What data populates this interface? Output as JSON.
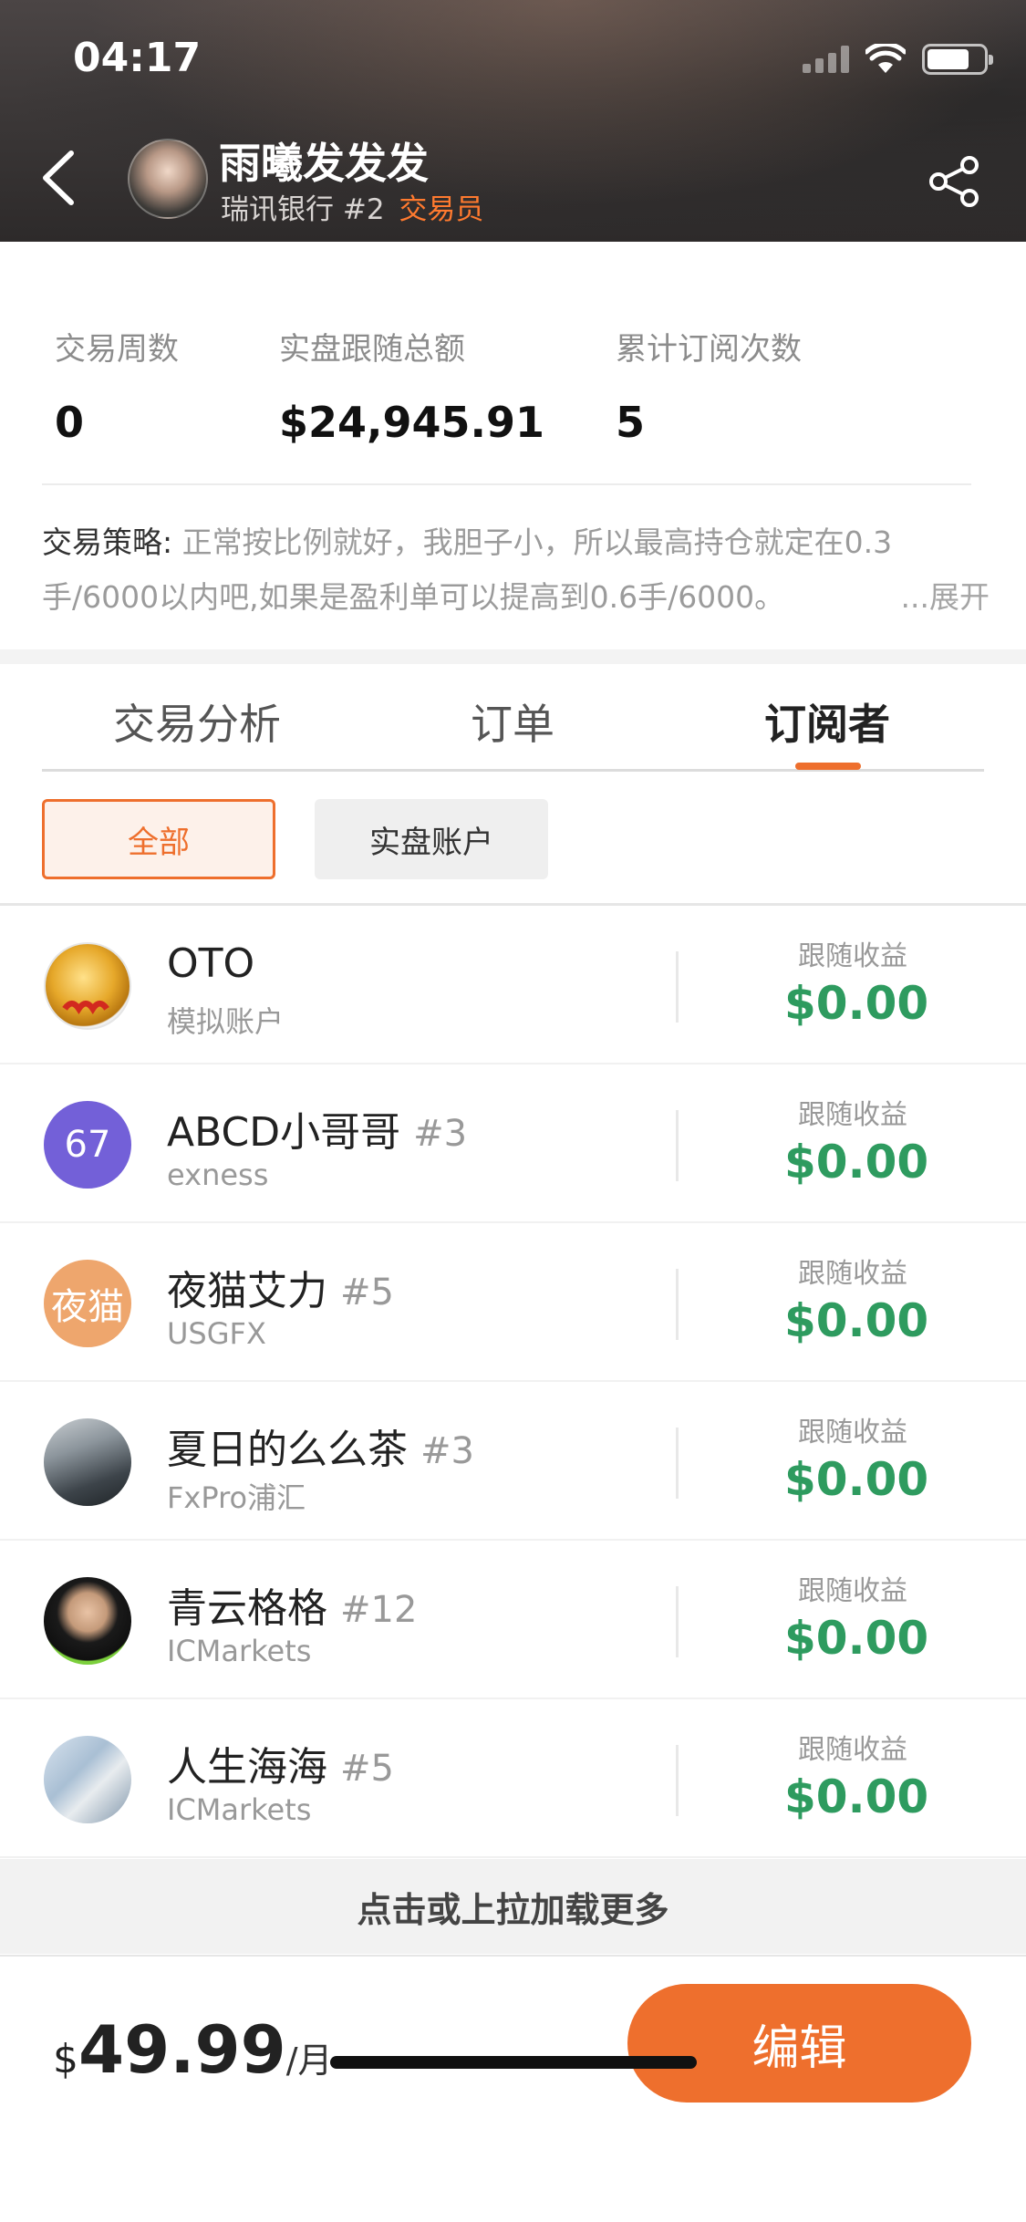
{
  "status_bar": {
    "time": "04:17"
  },
  "header": {
    "trader_name": "雨曦发发发",
    "bank": "瑞讯银行",
    "rank": "#2",
    "role": "交易员",
    "icons": {
      "back": "chevron-left-icon",
      "share": "share-icon"
    }
  },
  "stats": [
    {
      "label": "交易周数",
      "value": "0"
    },
    {
      "label": "实盘跟随总额",
      "value": "$24,945.91"
    },
    {
      "label": "累计订阅次数",
      "value": "5"
    }
  ],
  "strategy": {
    "label": "交易策略:",
    "text": " 正常按比例就好，我胆子小，所以最高持仓就定在0.3手/6000以内吧,如果是盈利单可以提高到0.6手/6000。",
    "expand": "...展开"
  },
  "tabs": [
    {
      "label": "交易分析",
      "active": false
    },
    {
      "label": "订单",
      "active": false
    },
    {
      "label": "订阅者",
      "active": true
    }
  ],
  "filters": [
    {
      "label": "全部",
      "active": true
    },
    {
      "label": "实盘账户",
      "active": false
    }
  ],
  "subscribers": [
    {
      "name": "OTO",
      "rank": "",
      "account": "模拟账户",
      "earn_label": "跟随收益",
      "earn_value": "$0.00",
      "avatar_text": "",
      "avatar_color": "#f5c24a"
    },
    {
      "name": "ABCD小哥哥",
      "rank": "#3",
      "account": "exness",
      "earn_label": "跟随收益",
      "earn_value": "$0.00",
      "avatar_text": "67",
      "avatar_color": "#7360d8"
    },
    {
      "name": "夜猫艾力",
      "rank": "#5",
      "account": "USGFX",
      "earn_label": "跟随收益",
      "earn_value": "$0.00",
      "avatar_text": "夜猫",
      "avatar_color": "#eea66d"
    },
    {
      "name": "夏日的么么茶",
      "rank": "#3",
      "account": "FxPro浦汇",
      "earn_label": "跟随收益",
      "earn_value": "$0.00",
      "avatar_text": "",
      "avatar_color": "#5e6a72"
    },
    {
      "name": "青云格格",
      "rank": "#12",
      "account": "ICMarkets",
      "earn_label": "跟随收益",
      "earn_value": "$0.00",
      "avatar_text": "",
      "avatar_color": "#2a2a2a"
    },
    {
      "name": "人生海海",
      "rank": "#5",
      "account": "ICMarkets",
      "earn_label": "跟随收益",
      "earn_value": "$0.00",
      "avatar_text": "",
      "avatar_color": "#9fb7cf"
    }
  ],
  "load_more": "点击或上拉加载更多",
  "bottom_bar": {
    "currency": "$",
    "price": "49.99",
    "period": "/月",
    "edit_label": "编辑"
  },
  "colors": {
    "accent": "#ee6f2d",
    "positive": "#2e9b5f"
  }
}
